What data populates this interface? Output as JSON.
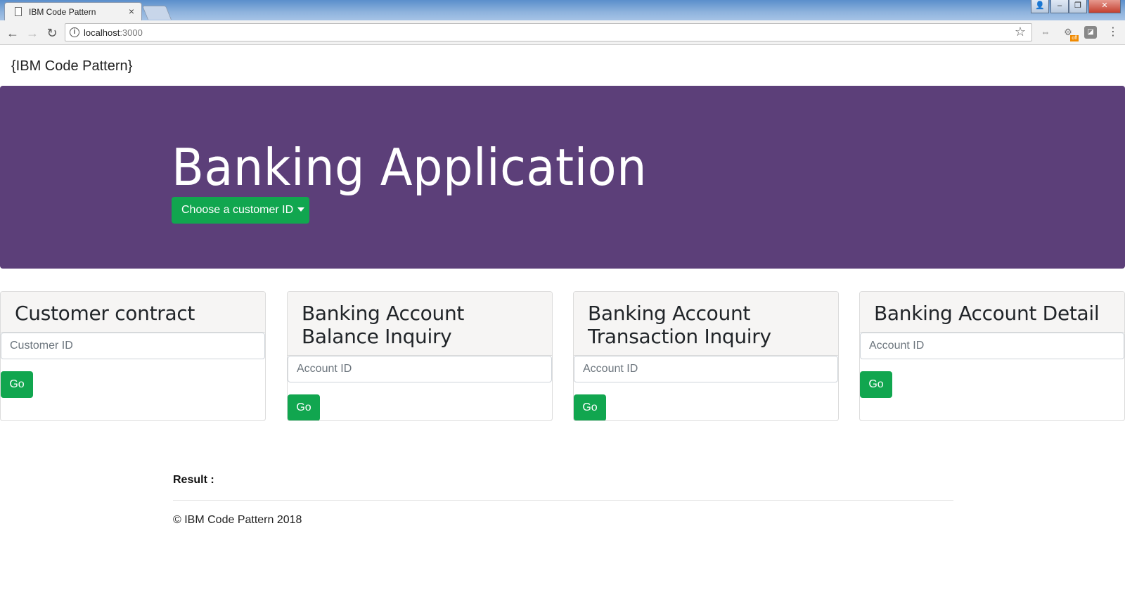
{
  "browser": {
    "tab_title": "IBM Code Pattern",
    "tab_close": "×",
    "url_host": "localhost",
    "url_port": ":3000",
    "window_buttons": {
      "user": "👤",
      "minimize": "–",
      "maximize": "❐",
      "close": "✕"
    },
    "nav": {
      "back": "←",
      "forward": "→",
      "reload": "↻"
    },
    "star": "☆",
    "extensions": [
      "ext-link-icon",
      "ext-off-icon",
      "ext-square-icon"
    ],
    "ext_off_label": "off",
    "menu": "⋮"
  },
  "page": {
    "brand": "{IBM Code Pattern}",
    "hero": {
      "title": "Banking Application",
      "dropdown_label": "Choose a customer ID",
      "bg_color": "#5c3f79",
      "button_color": "#11a64f"
    },
    "cards": [
      {
        "title": "Customer contract",
        "placeholder": "Customer ID",
        "button": "Go"
      },
      {
        "title": "Banking Account Balance Inquiry",
        "placeholder": "Account ID",
        "button": "Go"
      },
      {
        "title": "Banking Account Transaction Inquiry",
        "placeholder": "Account ID",
        "button": "Go"
      },
      {
        "title": "Banking Account Detail",
        "placeholder": "Account ID",
        "button": "Go"
      }
    ],
    "result_label": "Result :",
    "footer": "© IBM Code Pattern 2018"
  }
}
